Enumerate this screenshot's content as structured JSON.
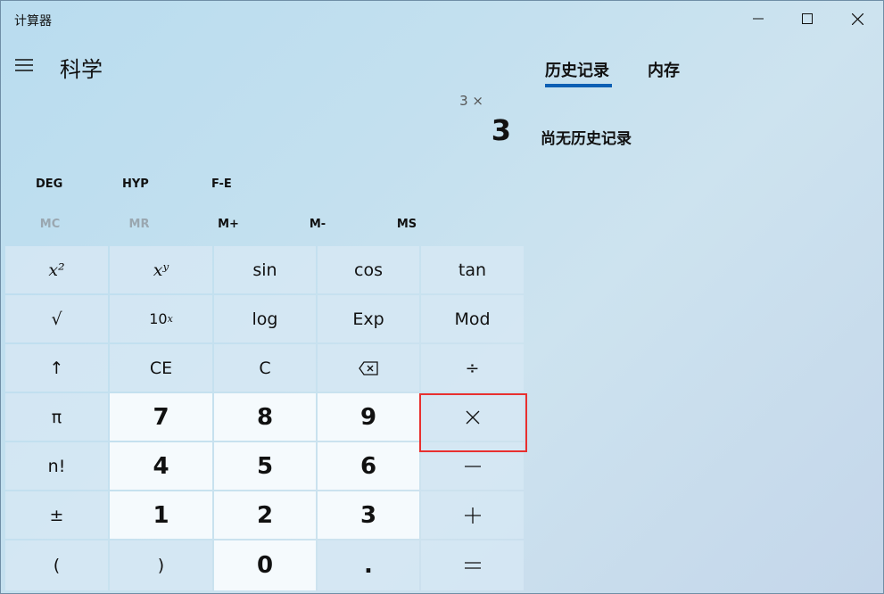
{
  "window": {
    "title": "计算器"
  },
  "header": {
    "mode_title": "科学",
    "menu_icon": "hamburger-menu-icon"
  },
  "display": {
    "expression": "3 ×",
    "result": "3"
  },
  "panel": {
    "tabs": [
      {
        "label": "历史记录",
        "active": true
      },
      {
        "label": "内存",
        "active": false
      }
    ],
    "empty_message": "尚无历史记录"
  },
  "modes": {
    "deg": "DEG",
    "hyp": "HYP",
    "fe": "F-E"
  },
  "memory": [
    {
      "label": "MC",
      "enabled": false
    },
    {
      "label": "MR",
      "enabled": false
    },
    {
      "label": "M+",
      "enabled": true
    },
    {
      "label": "M-",
      "enabled": true
    },
    {
      "label": "MS",
      "enabled": true
    }
  ],
  "keys": {
    "r1": [
      "x²",
      "xʸ",
      "sin",
      "cos",
      "tan"
    ],
    "sqrt": "√",
    "ten_pow": "10",
    "ten_pow_sup": "x",
    "log": "log",
    "exp": "Exp",
    "mod": "Mod",
    "second": "↑",
    "ce": "CE",
    "c": "C",
    "divide": "÷",
    "pi": "π",
    "n7": "7",
    "n8": "8",
    "n9": "9",
    "fact": "n!",
    "n4": "4",
    "n5": "5",
    "n6": "6",
    "negate": "±",
    "n1": "1",
    "n2": "2",
    "n3": "3",
    "lparen": "(",
    "rparen": ")",
    "n0": "0",
    "decimal": "."
  },
  "colors": {
    "accent": "#0c5fb4",
    "highlight": "#e8302f"
  }
}
